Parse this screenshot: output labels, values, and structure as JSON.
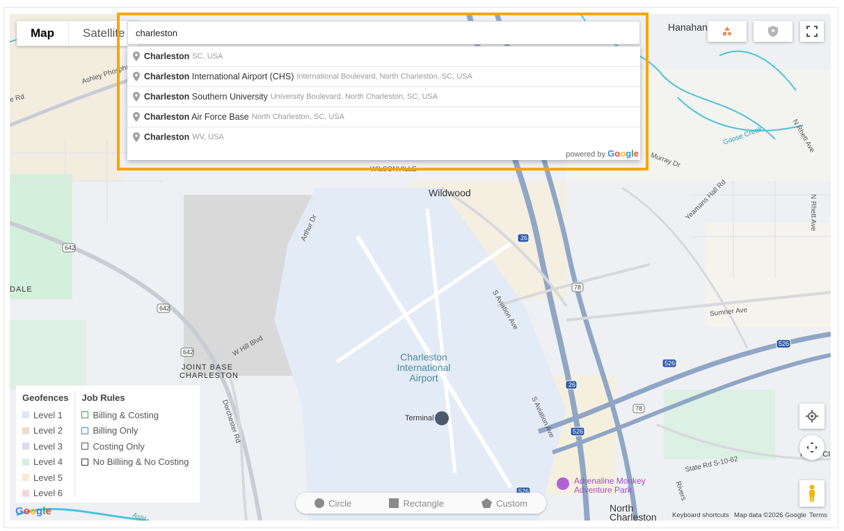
{
  "map_type": {
    "map_label": "Map",
    "satellite_label": "Satellite"
  },
  "search": {
    "value": "charleston"
  },
  "suggestions": [
    {
      "match": "Charleston",
      "rest": "",
      "secondary": "SC, USA"
    },
    {
      "match": "Charleston",
      "rest": " International Airport (CHS)",
      "secondary": "International Boulevard, North Charleston, SC, USA"
    },
    {
      "match": "Charleston",
      "rest": " Southern University",
      "secondary": "University Boulevard, North Charleston, SC, USA"
    },
    {
      "match": "Charleston",
      "rest": " Air Force Base",
      "secondary": "North Charleston, SC, USA"
    },
    {
      "match": "Charleston",
      "rest": "",
      "secondary": "WV, USA"
    }
  ],
  "powered_by": {
    "text": "powered by",
    "brand": "Google"
  },
  "map_labels": {
    "hanahan": "Hanahan",
    "wildwood": "Wildwood",
    "airport": "Charleston\nInternational\nAirport",
    "terminal": "Terminal",
    "joint_base": "JOINT BASE\nCHARLESTON",
    "dale": "DALE",
    "wilsonville": "WILSONVILLE",
    "north_charleston": "North\nCharleston",
    "adrenaline": "Adrenaline Monkey\nAdventure Park",
    "park_circle": "PARK CIR",
    "sumner": "Sumner Ave",
    "state_rd": "State Rd S-10-62",
    "aviation1": "S Aviation Ave",
    "aviation2": "S Aviation Ave",
    "w_hill": "W Hill Blvd",
    "arthur": "Arthur Dr",
    "dorchester": "Dorchester Rd",
    "yeamans": "Yeamans Hall Rd",
    "goose": "Goose Creek",
    "n_rhett": "N Rhett Ave",
    "n_rhett2": "N Rhett Ave",
    "murray": "Murray Dr",
    "ashley": "Ashley Phosphate",
    "e_rd": "e Rd",
    "ashl": "Ashl",
    "rivers": "Rivers",
    "r642a": "642",
    "r642b": "642",
    "r642c": "642",
    "r26a": "26",
    "r26b": "26",
    "r78a": "78",
    "r78b": "78",
    "r526a": "526",
    "r526b": "526",
    "r526c": "526",
    "r526d": "526"
  },
  "legend": {
    "geofences_title": "Geofences",
    "levels": [
      {
        "label": "Level 1",
        "color": "#dbe7f7"
      },
      {
        "label": "Level 2",
        "color": "#f5d9c9"
      },
      {
        "label": "Level 3",
        "color": "#dcdcf0"
      },
      {
        "label": "Level 4",
        "color": "#d6efdc"
      },
      {
        "label": "Level 5",
        "color": "#f8ead2"
      },
      {
        "label": "Level 6",
        "color": "#f7d6d6"
      }
    ],
    "job_rules_title": "Job Rules",
    "rules": [
      {
        "label": "Billing & Costing",
        "color": "#3aa33a"
      },
      {
        "label": "Billing Only",
        "color": "#3a8ed8"
      },
      {
        "label": "Costing Only",
        "color": "#555555"
      },
      {
        "label": "No Billiing & No Costing",
        "color": "#333333"
      }
    ]
  },
  "draw_tools": {
    "circle": "Circle",
    "rectangle": "Rectangle",
    "custom": "Custom"
  },
  "attribution": {
    "keyboard": "Keyboard shortcuts",
    "map_data": "Map data ©2026 Google",
    "terms": "Terms",
    "google_logo": "Google"
  },
  "icons": {
    "shapes": "shapes-icon",
    "shield": "shield-icon",
    "fullscreen": "fullscreen-icon",
    "locate": "my-location-icon",
    "camera": "camera-control-icon",
    "pegman": "pegman-icon",
    "pin": "place-pin-icon"
  },
  "colors": {
    "accent_highlight": "#f7a600",
    "highway": "#8fa6c4",
    "water": "#4cc3d9"
  }
}
